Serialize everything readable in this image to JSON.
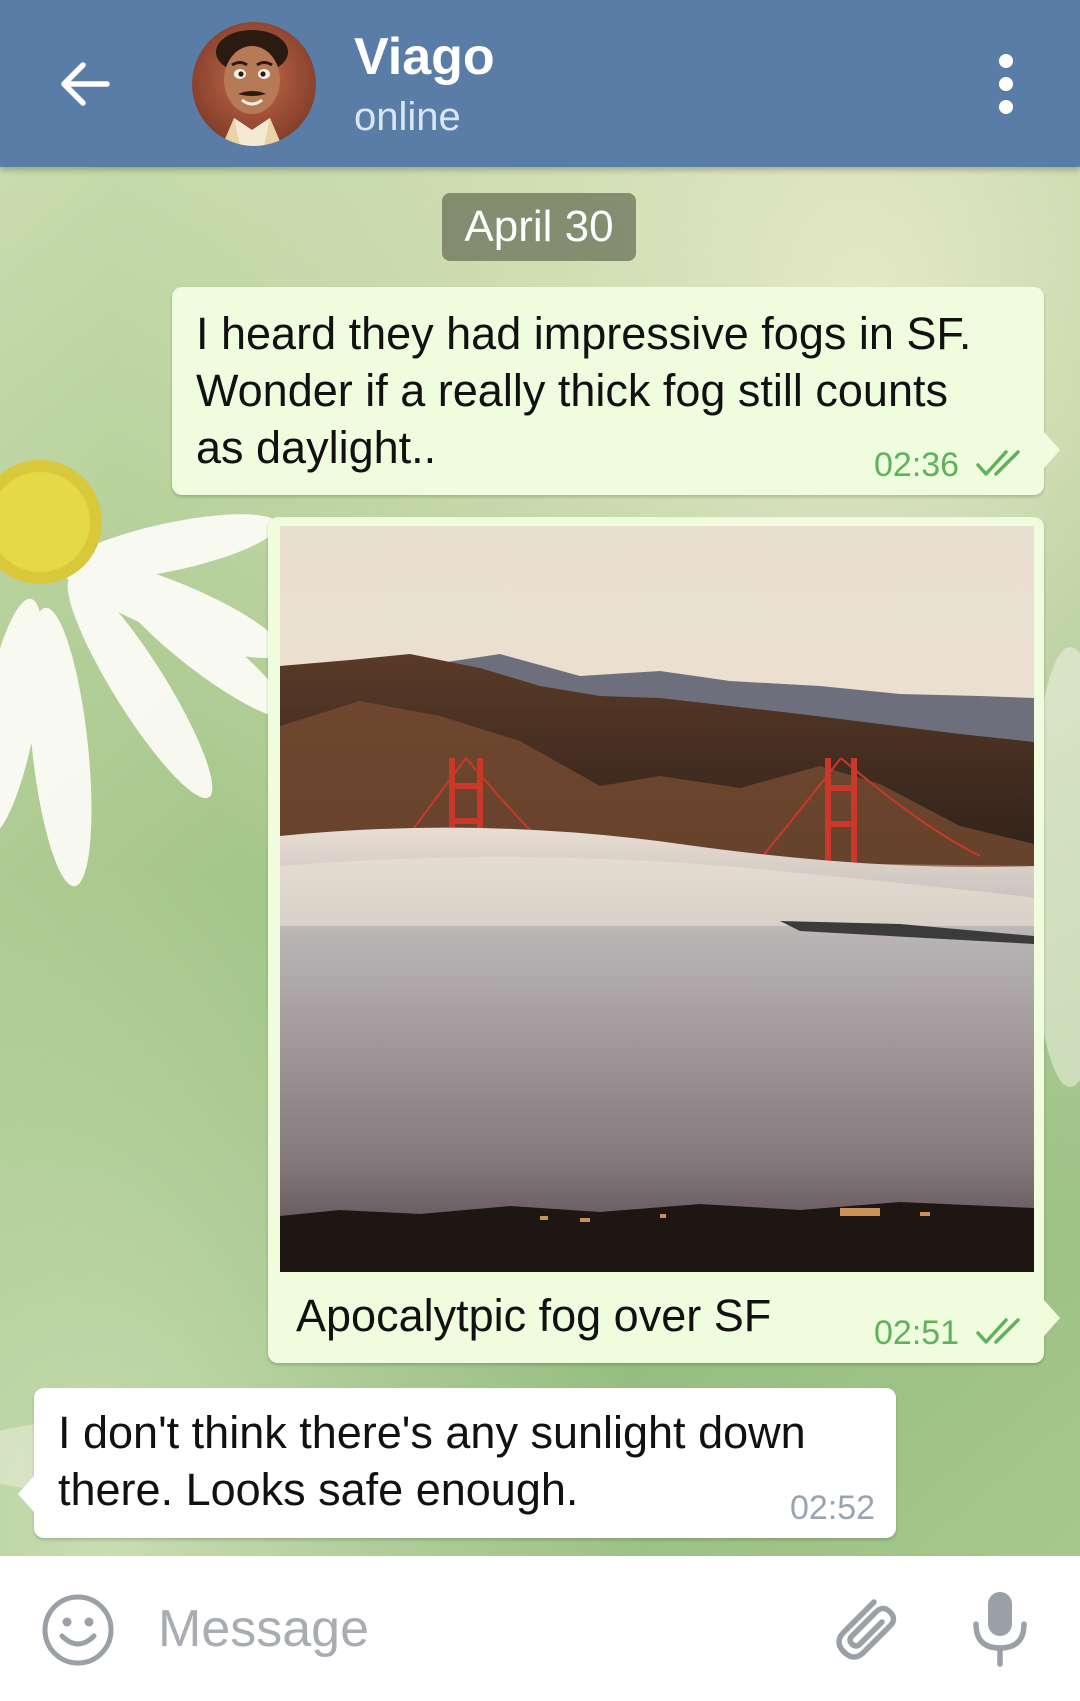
{
  "header": {
    "back_icon": "arrow-left-icon",
    "contact_name": "Viago",
    "status": "online",
    "menu_icon": "more-vertical-icon"
  },
  "chat": {
    "date_separator": "April 30",
    "messages": [
      {
        "direction": "outgoing",
        "lines": [
          "I heard they had impressive fogs in SF.",
          "Wonder if a really thick fog still counts",
          "as daylight.."
        ],
        "time": "02:36",
        "status_icon": "double-check-icon"
      },
      {
        "direction": "outgoing",
        "type": "photo",
        "caption": "Apocalytpic fog over SF",
        "time": "02:51",
        "status_icon": "double-check-icon"
      },
      {
        "direction": "incoming",
        "lines": [
          "I don't think there's any sunlight down",
          "there. Looks safe enough."
        ],
        "time": "02:52"
      }
    ]
  },
  "input": {
    "placeholder": "Message",
    "value": "",
    "emoji_icon": "emoji-icon",
    "attach_icon": "paperclip-icon",
    "mic_icon": "microphone-icon"
  },
  "colors": {
    "header_bg": "#5a7da7",
    "outgoing_bubble": "#effdde",
    "incoming_bubble": "#ffffff",
    "read_check": "#5fb25a"
  }
}
